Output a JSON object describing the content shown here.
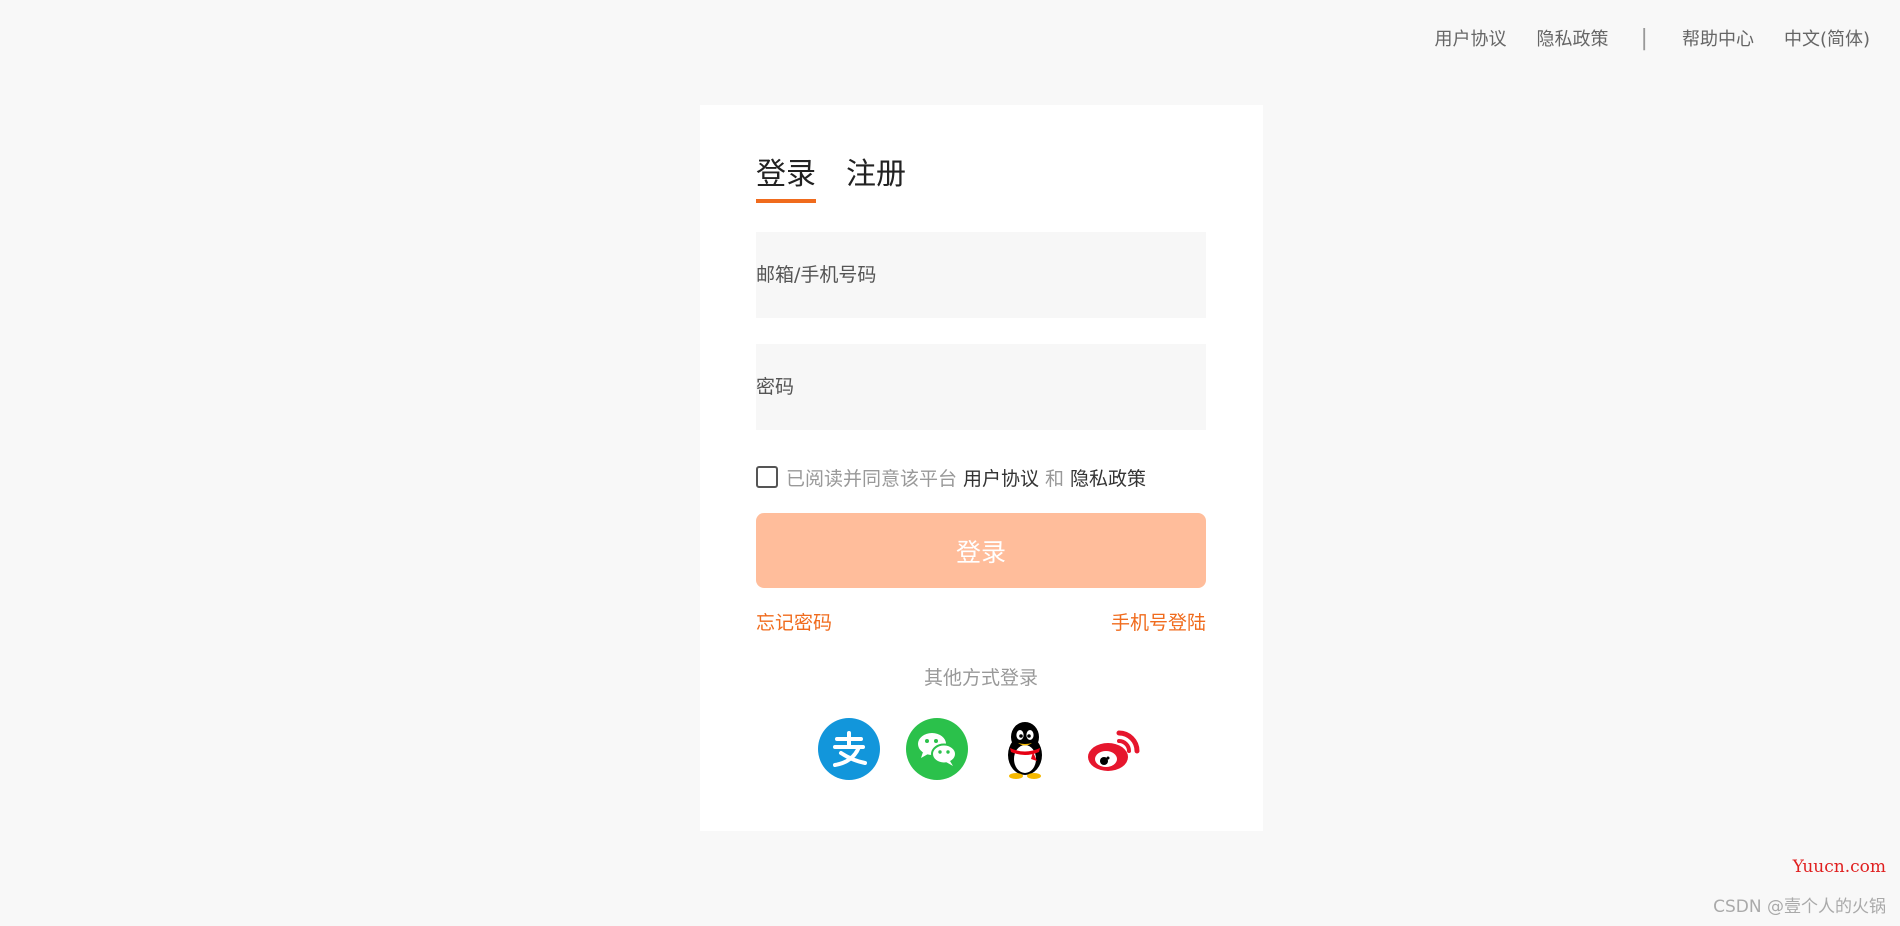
{
  "topnav": {
    "user_agreement": "用户协议",
    "privacy_policy": "隐私政策",
    "separator": "|",
    "help_center": "帮助中心",
    "language": "中文(简体)"
  },
  "tabs": {
    "login": "登录",
    "register": "注册"
  },
  "form": {
    "account_placeholder": "邮箱/手机号码",
    "account_value": "",
    "password_placeholder": "密码",
    "password_value": "",
    "agree_checked": false,
    "agree_text": "已阅读并同意该平台",
    "agree_link_user": "用户协议",
    "agree_and": "和",
    "agree_link_privacy": "隐私政策",
    "submit_label": "登录",
    "forgot_password": "忘记密码",
    "phone_login": "手机号登陆",
    "other_methods": "其他方式登录"
  },
  "social": [
    {
      "icon": "alipay-icon",
      "color": "#1296db"
    },
    {
      "icon": "wechat-icon",
      "color": "#2bc14b"
    },
    {
      "icon": "qq-icon",
      "color": "#000000"
    },
    {
      "icon": "weibo-icon",
      "color": "#e6162d"
    }
  ],
  "colors": {
    "accent": "#f06b1d",
    "button_disabled": "#ffbd9b",
    "page_bg": "#f8f8f8"
  },
  "watermark": "Yuucn.com",
  "footer_credit": "CSDN @壹个人的火锅"
}
